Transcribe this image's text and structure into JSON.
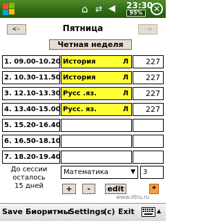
{
  "status_bar": {
    "time": "23:30",
    "battery": "95%",
    "start_icon": "windows-flag-icon",
    "icons": [
      "home-icon",
      "connectivity-icon",
      "volume-icon",
      "close-icon"
    ]
  },
  "header": {
    "prev_label": "<-",
    "next_label": "->",
    "day": "Пятница",
    "week": "Четная неделя"
  },
  "lessons": [
    {
      "time": "1. 09.00-10.20",
      "subject": "История",
      "type": "Л",
      "room": "227"
    },
    {
      "time": "2. 10.30-11.50",
      "subject": "История",
      "type": "Л",
      "room": "227"
    },
    {
      "time": "3. 12.10-13.30",
      "subject": "Русс .яз.",
      "type": "Л",
      "room": "227"
    },
    {
      "time": "4. 13.40-15.00",
      "subject": "Русс. яз.",
      "type": "Л",
      "room": "227"
    },
    {
      "time": "5. 15.20-16.40",
      "subject": "",
      "type": "",
      "room": ""
    },
    {
      "time": "6. 16.50-18.10",
      "subject": "",
      "type": "",
      "room": ""
    },
    {
      "time": "7. 18.20-19.40",
      "subject": "",
      "type": "",
      "room": ""
    }
  ],
  "session": {
    "line1": "До сессии",
    "line2": "осталось",
    "line3": "15 дней"
  },
  "controls": {
    "subject_selected": "Математика",
    "count_value": "3",
    "plus_label": "+",
    "minus_label": "-",
    "edit_label": "edit",
    "star_label": "*"
  },
  "menu": {
    "save": "Save",
    "biorhythms": "Биоритмы",
    "settings": "Settings",
    "about": "(c)",
    "exit": "Exit"
  },
  "watermark": "www.litru.ru",
  "colors": {
    "titlebar": "#2e6a14",
    "subject_fill": "#ffff33",
    "button_bg": "#e6dcd2",
    "star_button": "#f4a040"
  }
}
